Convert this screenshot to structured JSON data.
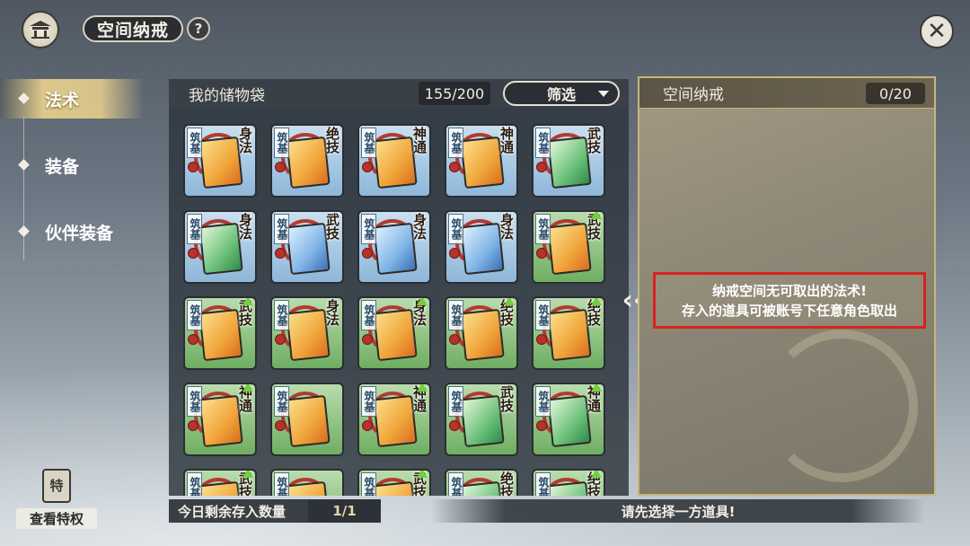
{
  "header": {
    "title": "空间纳戒",
    "help": "?",
    "close": "✕",
    "home_icon": "pavilion-icon"
  },
  "nav": {
    "items": [
      {
        "label": "法术",
        "active": true
      },
      {
        "label": "装备",
        "active": false
      },
      {
        "label": "伙伴装备",
        "active": false
      }
    ]
  },
  "storage": {
    "title": "我的储物袋",
    "count": "155/200",
    "filter_label": "筛选",
    "items": [
      {
        "tier": "筑基",
        "type": "身法",
        "bg": "blue",
        "color": "orange",
        "upgrade": false
      },
      {
        "tier": "筑基",
        "type": "绝技",
        "bg": "blue",
        "color": "orange",
        "upgrade": false
      },
      {
        "tier": "筑基",
        "type": "神通",
        "bg": "blue",
        "color": "orange",
        "upgrade": false
      },
      {
        "tier": "筑基",
        "type": "神通",
        "bg": "blue",
        "color": "orange",
        "upgrade": false
      },
      {
        "tier": "筑基",
        "type": "武技",
        "bg": "blue",
        "color": "green",
        "upgrade": false
      },
      {
        "tier": "筑基",
        "type": "身法",
        "bg": "blue",
        "color": "green",
        "upgrade": false
      },
      {
        "tier": "筑基",
        "type": "武技",
        "bg": "blue",
        "color": "blue",
        "upgrade": false
      },
      {
        "tier": "筑基",
        "type": "身法",
        "bg": "blue",
        "color": "blue",
        "upgrade": false
      },
      {
        "tier": "筑基",
        "type": "身法",
        "bg": "blue",
        "color": "blue",
        "upgrade": false
      },
      {
        "tier": "筑基",
        "type": "武技",
        "bg": "green",
        "color": "orange",
        "upgrade": true
      },
      {
        "tier": "筑基",
        "type": "武技",
        "bg": "green",
        "color": "orange",
        "upgrade": true
      },
      {
        "tier": "筑基",
        "type": "身法",
        "bg": "green",
        "color": "orange",
        "upgrade": false
      },
      {
        "tier": "筑基",
        "type": "身法",
        "bg": "green",
        "color": "orange",
        "upgrade": true
      },
      {
        "tier": "筑基",
        "type": "绝技",
        "bg": "green",
        "color": "orange",
        "upgrade": true
      },
      {
        "tier": "筑基",
        "type": "绝技",
        "bg": "green",
        "color": "orange",
        "upgrade": true
      },
      {
        "tier": "筑基",
        "type": "神通",
        "bg": "green",
        "color": "orange",
        "upgrade": true
      },
      {
        "tier": "筑基",
        "type": "",
        "bg": "green",
        "color": "orange",
        "upgrade": false
      },
      {
        "tier": "筑基",
        "type": "神通",
        "bg": "green",
        "color": "orange",
        "upgrade": true
      },
      {
        "tier": "筑基",
        "type": "武技",
        "bg": "green",
        "color": "green",
        "upgrade": false
      },
      {
        "tier": "筑基",
        "type": "神通",
        "bg": "green",
        "color": "green",
        "upgrade": true
      },
      {
        "tier": "筑基",
        "type": "武技",
        "bg": "green",
        "color": "orange",
        "upgrade": true
      },
      {
        "tier": "筑基",
        "type": "",
        "bg": "green",
        "color": "orange",
        "upgrade": false
      },
      {
        "tier": "筑基",
        "type": "武技",
        "bg": "green",
        "color": "orange",
        "upgrade": true
      },
      {
        "tier": "筑基",
        "type": "绝技",
        "bg": "green",
        "color": "green",
        "upgrade": false
      },
      {
        "tier": "筑基",
        "type": "绝技",
        "bg": "green",
        "color": "green",
        "upgrade": true
      }
    ]
  },
  "ring": {
    "title": "空间纳戒",
    "count": "0/20",
    "notice_line1": "纳戒空间无可取出的法术!",
    "notice_line2": "存入的道具可被账号下任意角色取出"
  },
  "bottom": {
    "remaining_label": "今日剩余存入数量",
    "remaining_value": "1/1",
    "hint": "请先选择一方道具!"
  },
  "privilege": {
    "label": "查看特权",
    "glyph": "特",
    "icon": "scroll-icon"
  },
  "colors": {
    "highlight": "#d8231e",
    "accent_gold": "#c9b47c",
    "upgrade_green": "#6fd13b"
  }
}
